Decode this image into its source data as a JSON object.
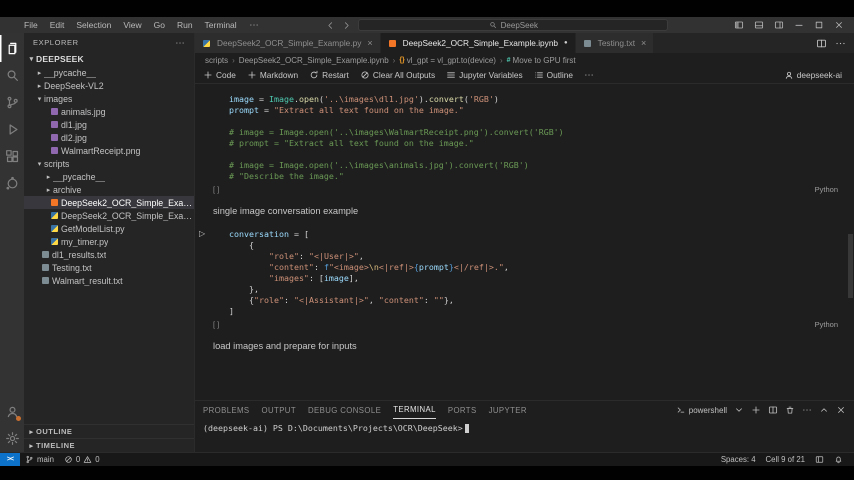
{
  "colors": {
    "accent_blue": "#007acc",
    "titlebar_bg": "#323233",
    "activitybar_bg": "#333333",
    "sidebar_bg": "#252526",
    "editor_bg": "#1e1e1e",
    "statusbar_bg": "#181818",
    "selection_bg": "#37373d",
    "tab_inactive_bg": "#2d2d2d",
    "syntax_variable": "#9cdcfe",
    "syntax_class": "#4ec9b0",
    "syntax_function": "#dcdcaa",
    "syntax_string": "#ce9178",
    "syntax_comment": "#6a9955",
    "syntax_keyword": "#569cd6",
    "remote_badge": "#0d72c9",
    "notebook_icon": "#f37626"
  },
  "title_bar": {
    "menus": [
      "File",
      "Edit",
      "Selection",
      "View",
      "Go",
      "Run",
      "Terminal"
    ],
    "search_text": "DeepSeek",
    "window_controls": [
      "layout-sidebar",
      "layout-panel",
      "layout-sidebar-right",
      "minimize",
      "maximize",
      "close"
    ]
  },
  "activity_bar": {
    "top": [
      "explorer",
      "search",
      "source-control",
      "run-and-debug",
      "extensions",
      "jupyter"
    ],
    "bottom": [
      "account",
      "settings-gear"
    ]
  },
  "sidebar": {
    "header": "EXPLORER",
    "root": "DEEPSEEK",
    "tree": [
      {
        "label": "__pycache__",
        "type": "folder",
        "depth": 1,
        "expanded": false
      },
      {
        "label": "DeepSeek-VL2",
        "type": "folder",
        "depth": 1,
        "expanded": false
      },
      {
        "label": "images",
        "type": "folder",
        "depth": 1,
        "expanded": true
      },
      {
        "label": "animals.jpg",
        "type": "image",
        "depth": 2
      },
      {
        "label": "dl1.jpg",
        "type": "image",
        "depth": 2
      },
      {
        "label": "dl2.jpg",
        "type": "image",
        "depth": 2
      },
      {
        "label": "WalmartReceipt.png",
        "type": "image",
        "depth": 2
      },
      {
        "label": "scripts",
        "type": "folder",
        "depth": 1,
        "expanded": true
      },
      {
        "label": "__pycache__",
        "type": "folder",
        "depth": 2,
        "expanded": false
      },
      {
        "label": "archive",
        "type": "folder",
        "depth": 2,
        "expanded": false
      },
      {
        "label": "DeepSeek2_OCR_Simple_Example.ipynb",
        "type": "notebook",
        "depth": 2,
        "selected": true
      },
      {
        "label": "DeepSeek2_OCR_Simple_Example.py",
        "type": "python",
        "depth": 2
      },
      {
        "label": "GetModelList.py",
        "type": "python",
        "depth": 2
      },
      {
        "label": "my_timer.py",
        "type": "python",
        "depth": 2
      },
      {
        "label": "dl1_results.txt",
        "type": "text",
        "depth": 1
      },
      {
        "label": "Testing.txt",
        "type": "text",
        "depth": 1
      },
      {
        "label": "Walmart_result.txt",
        "type": "text",
        "depth": 1
      }
    ],
    "bottom_sections": [
      "OUTLINE",
      "TIMELINE"
    ]
  },
  "tabs": {
    "items": [
      {
        "label": "DeepSeek2_OCR_Simple_Example.py",
        "icon": "python",
        "active": false,
        "modified": false
      },
      {
        "label": "DeepSeek2_OCR_Simple_Example.ipynb",
        "icon": "notebook",
        "active": true,
        "modified": true
      },
      {
        "label": "Testing.txt",
        "icon": "text",
        "active": false,
        "modified": false
      }
    ],
    "actions": [
      "split",
      "more"
    ]
  },
  "breadcrumb": {
    "items": [
      {
        "label": "scripts"
      },
      {
        "label": "DeepSeek2_OCR_Simple_Example.ipynb"
      },
      {
        "label": "vl_gpt = vl_gpt.to(device)",
        "icon": "code"
      },
      {
        "label": "Move to GPU first",
        "icon": "marker"
      }
    ]
  },
  "notebook_toolbar": {
    "actions": [
      {
        "id": "add-code-button",
        "icon": "plus",
        "label": "Code"
      },
      {
        "id": "add-markdown-button",
        "icon": "plus",
        "label": "Markdown"
      },
      {
        "id": "restart-button",
        "icon": "restart",
        "label": "Restart"
      },
      {
        "id": "clear-all-outputs-button",
        "icon": "clear-all",
        "label": "Clear All Outputs"
      },
      {
        "id": "jupyter-variables-button",
        "icon": "variables",
        "label": "Jupyter Variables"
      },
      {
        "id": "outline-button",
        "icon": "outline",
        "label": "Outline"
      },
      {
        "id": "more-actions-button",
        "icon": "more"
      }
    ],
    "kernel": "deepseek-ai"
  },
  "cells": [
    {
      "type": "code",
      "exec_label": "[ ]",
      "lang": "Python",
      "show_run": false,
      "lines": [
        [
          [
            "image",
            "v"
          ],
          [
            " = ",
            "p"
          ],
          [
            "Image",
            "c"
          ],
          [
            ".",
            "p"
          ],
          [
            "open",
            "f"
          ],
          [
            "(",
            "p"
          ],
          [
            "'..\\images\\dl1.jpg'",
            "s"
          ],
          [
            ")",
            "p"
          ],
          [
            ".",
            "p"
          ],
          [
            "convert",
            "f"
          ],
          [
            "(",
            "p"
          ],
          [
            "'RGB'",
            "s"
          ],
          [
            ")",
            "p"
          ]
        ],
        [
          [
            "prompt",
            "v"
          ],
          [
            " = ",
            "p"
          ],
          [
            "\"Extract all text found on the image.\"",
            "s"
          ]
        ],
        [],
        [
          [
            "# image = Image.open('..\\images\\WalmartReceipt.png').convert('RGB')",
            "cm"
          ]
        ],
        [
          [
            "# prompt = \"Extract all text found on the image.\"",
            "cm"
          ]
        ],
        [],
        [
          [
            "# image = Image.open('..\\images\\animals.jpg').convert('RGB')",
            "cm"
          ]
        ],
        [
          [
            "# \"Describe the image.\"",
            "cm"
          ]
        ]
      ]
    },
    {
      "type": "markdown",
      "text": "single image conversation example"
    },
    {
      "type": "code",
      "exec_label": "[ ]",
      "lang": "Python",
      "show_run": true,
      "lines": [
        [
          [
            "conversation",
            "v"
          ],
          [
            " = [",
            "p"
          ]
        ],
        [
          [
            "    {",
            "p"
          ]
        ],
        [
          [
            "        ",
            "p"
          ],
          [
            "\"role\"",
            "s"
          ],
          [
            ": ",
            "p"
          ],
          [
            "\"<|User|>\"",
            "s"
          ],
          [
            ",",
            "p"
          ]
        ],
        [
          [
            "        ",
            "p"
          ],
          [
            "\"content\"",
            "s"
          ],
          [
            ": ",
            "p"
          ],
          [
            "f",
            "k"
          ],
          [
            "\"<image>",
            "s"
          ],
          [
            "\\n",
            "e"
          ],
          [
            "<|ref|>",
            "s"
          ],
          [
            "{",
            "b"
          ],
          [
            "prompt",
            "v"
          ],
          [
            "}",
            "b"
          ],
          [
            "<|/ref|>.\"",
            "s"
          ],
          [
            ",",
            "p"
          ]
        ],
        [
          [
            "        ",
            "p"
          ],
          [
            "\"images\"",
            "s"
          ],
          [
            ": [",
            "p"
          ],
          [
            "image",
            "v"
          ],
          [
            "],",
            "p"
          ]
        ],
        [
          [
            "    },",
            "p"
          ]
        ],
        [
          [
            "    {",
            "p"
          ],
          [
            "\"role\"",
            "s"
          ],
          [
            ": ",
            "p"
          ],
          [
            "\"<|Assistant|>\"",
            "s"
          ],
          [
            ", ",
            "p"
          ],
          [
            "\"content\"",
            "s"
          ],
          [
            ": ",
            "p"
          ],
          [
            "\"\"",
            "s"
          ],
          [
            "},",
            "p"
          ]
        ],
        [
          [
            "]",
            "p"
          ]
        ]
      ]
    },
    {
      "type": "markdown",
      "text": "load images and prepare for inputs"
    }
  ],
  "panel": {
    "tabs": [
      "PROBLEMS",
      "OUTPUT",
      "DEBUG CONSOLE",
      "TERMINAL",
      "PORTS",
      "JUPYTER"
    ],
    "active_tab": "TERMINAL",
    "controls": [
      {
        "name": "shell-selector",
        "icon": "terminal-ps",
        "label": "powershell"
      },
      {
        "name": "shell-dropdown",
        "icon": "chevron-down"
      },
      {
        "name": "new-terminal-button",
        "icon": "plus"
      },
      {
        "name": "split-terminal-button",
        "icon": "split"
      },
      {
        "name": "kill-terminal-button",
        "icon": "trash"
      },
      {
        "name": "terminal-more-button",
        "icon": "more"
      },
      {
        "name": "maximize-panel-button",
        "icon": "chevron-up"
      },
      {
        "name": "close-panel-button",
        "icon": "close"
      }
    ],
    "prompt": "(deepseek-ai) PS D:\\Documents\\Projects\\OCR\\DeepSeek>"
  },
  "status_bar": {
    "branch": "main",
    "errors": "0",
    "warnings": "0",
    "spaces": "Spaces: 4",
    "cell_indicator": "Cell 9 of 21"
  }
}
